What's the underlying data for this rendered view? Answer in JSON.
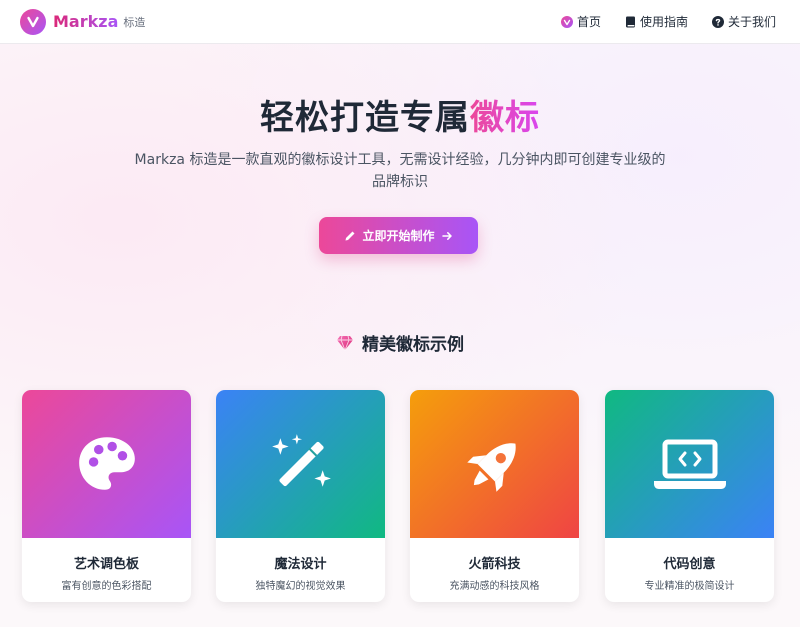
{
  "header": {
    "brand_name": "Markza",
    "brand_sub": "标造",
    "nav": [
      {
        "label": "首页",
        "icon": "heart-badge-icon"
      },
      {
        "label": "使用指南",
        "icon": "book-icon"
      },
      {
        "label": "关于我们",
        "icon": "question-circle-icon"
      }
    ]
  },
  "hero": {
    "title_plain": "轻松打造专属",
    "title_accent": "徽标",
    "description_line1": "Markza 标造是一款直观的徽标设计工具，无需设计经验，几分钟内即可创建专业级的",
    "description_line2": "品牌标识",
    "cta_label": "立即开始制作"
  },
  "showcase": {
    "title": "精美徽标示例",
    "cards": [
      {
        "title": "艺术调色板",
        "desc": "富有创意的色彩搭配",
        "icon": "palette-icon",
        "gradient": [
          "#ec4899",
          "#a855f7"
        ]
      },
      {
        "title": "魔法设计",
        "desc": "独特魔幻的视觉效果",
        "icon": "magic-wand-icon",
        "gradient": [
          "#3b82f6",
          "#10b981"
        ]
      },
      {
        "title": "火箭科技",
        "desc": "充满动感的科技风格",
        "icon": "rocket-icon",
        "gradient": [
          "#f59e0b",
          "#ef4444"
        ]
      },
      {
        "title": "代码创意",
        "desc": "专业精准的极简设计",
        "icon": "laptop-code-icon",
        "gradient": [
          "#10b981",
          "#3b82f6"
        ]
      }
    ]
  },
  "colors": {
    "accent_pink": "#ec4899",
    "accent_purple": "#a855f7",
    "text_dark": "#1f2937",
    "text_muted": "#4b5563"
  }
}
